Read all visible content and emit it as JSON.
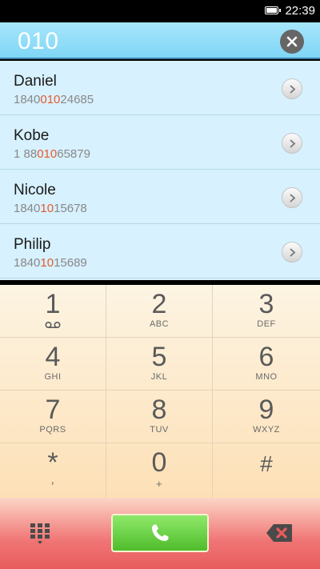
{
  "status_bar": {
    "time": "22:39",
    "battery_icon": "battery-full-icon"
  },
  "dialer": {
    "input_value": "010",
    "clear_icon": "close-icon"
  },
  "contacts": [
    {
      "name": "Daniel",
      "number_pre": "1840",
      "number_match": "010",
      "number_post": "24685"
    },
    {
      "name": "Kobe",
      "number_pre": "1 88",
      "number_match": "010",
      "number_post": "65879"
    },
    {
      "name": "Nicole",
      "number_pre": "1840",
      "number_match": "10",
      "number_post": "15678"
    },
    {
      "name": "Philip",
      "number_pre": "1840",
      "number_match": "10",
      "number_post": "15689"
    }
  ],
  "keypad": [
    {
      "digit": "1",
      "letters": ""
    },
    {
      "digit": "2",
      "letters": "ABC"
    },
    {
      "digit": "3",
      "letters": "DEF"
    },
    {
      "digit": "4",
      "letters": "GHI"
    },
    {
      "digit": "5",
      "letters": "JKL"
    },
    {
      "digit": "6",
      "letters": "MNO"
    },
    {
      "digit": "7",
      "letters": "PQRS"
    },
    {
      "digit": "8",
      "letters": "TUV"
    },
    {
      "digit": "9",
      "letters": "WXYZ"
    },
    {
      "digit": "*",
      "letters": ","
    },
    {
      "digit": "0",
      "letters": "+"
    },
    {
      "digit": "#",
      "letters": ""
    }
  ],
  "actions": {
    "dialpad_icon": "dialpad-grid-icon",
    "call_icon": "phone-icon",
    "backspace_icon": "backspace-icon"
  },
  "colors": {
    "highlight": "#e55a28",
    "call_button": "#5ccb35",
    "input_bar": "#8ddcf8"
  }
}
